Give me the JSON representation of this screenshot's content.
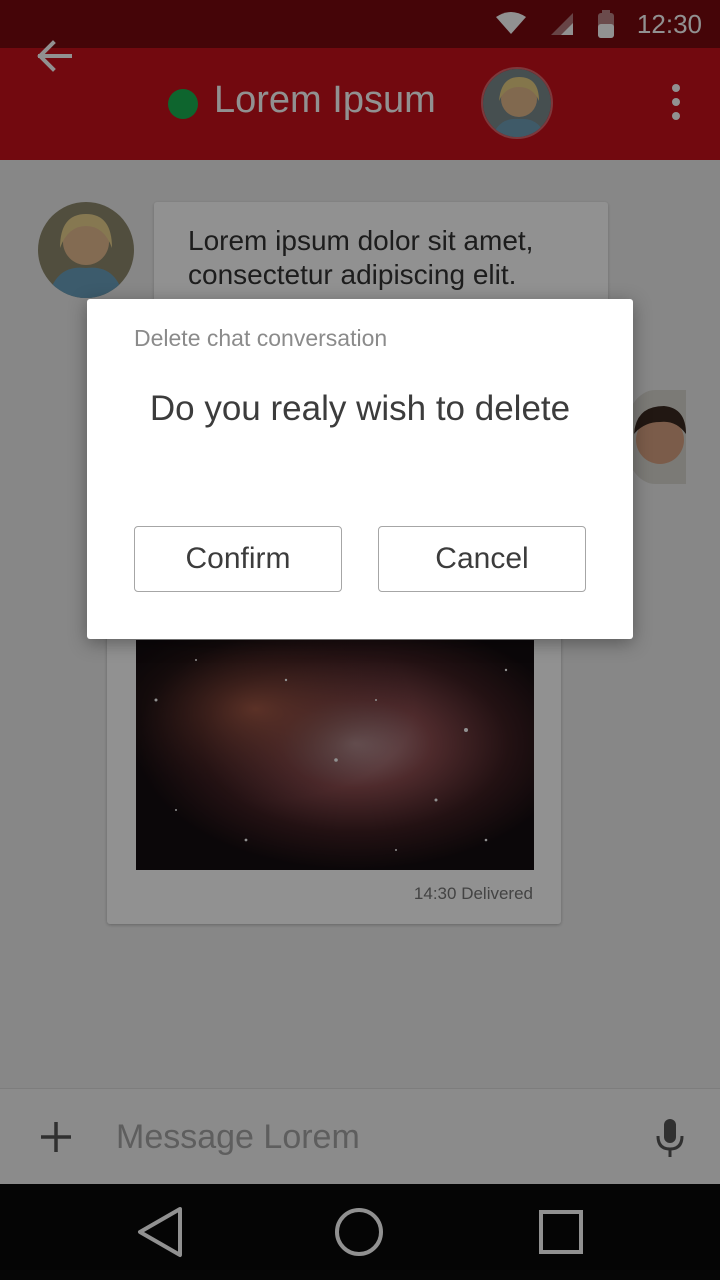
{
  "status_bar": {
    "time": "12:30",
    "icons": [
      "wifi-icon",
      "cell-signal-icon",
      "battery-icon"
    ]
  },
  "header": {
    "contact_name": "Lorem Ipsum",
    "online_color": "#1ab251",
    "brand_color": "#c9111b",
    "icons": [
      "back-arrow-icon",
      "more-vert-icon"
    ]
  },
  "conversation": {
    "incoming_message": {
      "text": "Lorem ipsum dolor sit amet, consectetur adipiscing elit."
    },
    "image_message": {
      "time": "14:30",
      "status": "Delivered"
    }
  },
  "composer": {
    "placeholder": "Message Lorem",
    "icons": [
      "add-icon",
      "microphone-icon"
    ]
  },
  "navigation": {
    "icons": [
      "nav-back-icon",
      "nav-home-icon",
      "nav-recents-icon"
    ]
  },
  "dialog": {
    "caption": "Delete chat conversation",
    "question": "Do you realy wish to delete",
    "confirm_label": "Confirm",
    "cancel_label": "Cancel"
  }
}
